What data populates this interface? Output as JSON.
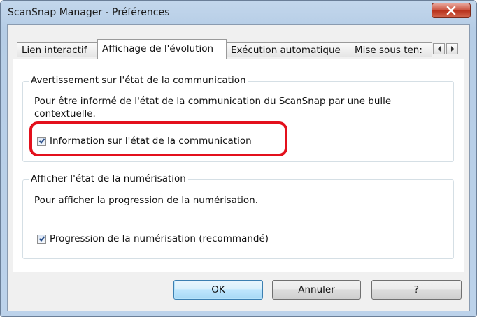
{
  "window": {
    "title": "ScanSnap Manager - Préférences"
  },
  "tabs": [
    {
      "label": "Lien interactif"
    },
    {
      "label": "Affichage de l'évolution"
    },
    {
      "label": "Exécution automatique"
    },
    {
      "label": "Mise sous ten:"
    }
  ],
  "communication_group": {
    "title": "Avertissement sur l'état de la communication",
    "description_line1": "Pour être informé de l'état de la communication du ScanSnap par une bulle",
    "description_line2": "contextuelle.",
    "checkbox_label": "Information sur l'état de la communication",
    "checked": true
  },
  "scan_group": {
    "title": "Afficher l'état de la numérisation",
    "description": "Pour afficher la progression de la numérisation.",
    "checkbox_label": "Progression de la numérisation (recommandé)",
    "checked": true
  },
  "buttons": {
    "ok": "OK",
    "cancel": "Annuler",
    "help": "?"
  },
  "colors": {
    "highlight": "#e3101c",
    "close_button": "#c9503c"
  }
}
